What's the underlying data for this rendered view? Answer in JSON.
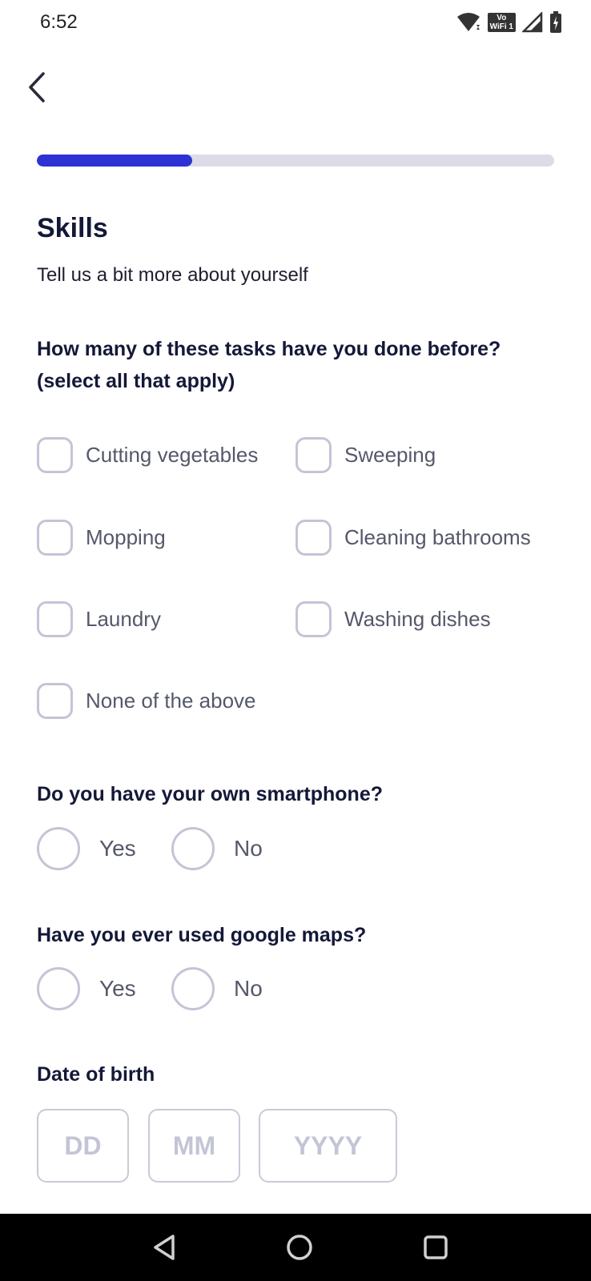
{
  "status_bar": {
    "time": "6:52",
    "vowifi_top": "Vo",
    "vowifi_bottom": "WiFi 1",
    "icons": [
      "wifi-icon",
      "vowifi-icon",
      "signal-icon",
      "battery-charging-icon"
    ]
  },
  "header": {
    "back_icon": "chevron-left-icon"
  },
  "progress": {
    "fraction": 0.3,
    "fill_color": "#2e32d4",
    "track_color": "#dcdce8"
  },
  "page": {
    "title": "Skills",
    "subtitle": "Tell us a bit more about yourself"
  },
  "tasks_question": {
    "line1": "How many of these tasks have you done before?",
    "line2": "(select all that apply)",
    "options": [
      {
        "label": "Cutting vegetables",
        "checked": false
      },
      {
        "label": "Sweeping",
        "checked": false
      },
      {
        "label": "Mopping",
        "checked": false
      },
      {
        "label": "Cleaning bathrooms",
        "checked": false
      },
      {
        "label": "Laundry",
        "checked": false
      },
      {
        "label": "Washing dishes",
        "checked": false
      },
      {
        "label": "None of the above",
        "checked": false
      }
    ]
  },
  "smartphone_question": {
    "text": "Do you have your own smartphone?",
    "yes": "Yes",
    "no": "No",
    "selected": null
  },
  "maps_question": {
    "text": "Have you ever used google maps?",
    "yes": "Yes",
    "no": "No",
    "selected": null
  },
  "dob": {
    "label": "Date of birth",
    "day_placeholder": "DD",
    "month_placeholder": "MM",
    "year_placeholder": "YYYY",
    "day_value": "",
    "month_value": "",
    "year_value": ""
  },
  "nav_bar": {
    "icons": [
      "back-triangle-icon",
      "home-circle-icon",
      "recents-square-icon"
    ]
  }
}
